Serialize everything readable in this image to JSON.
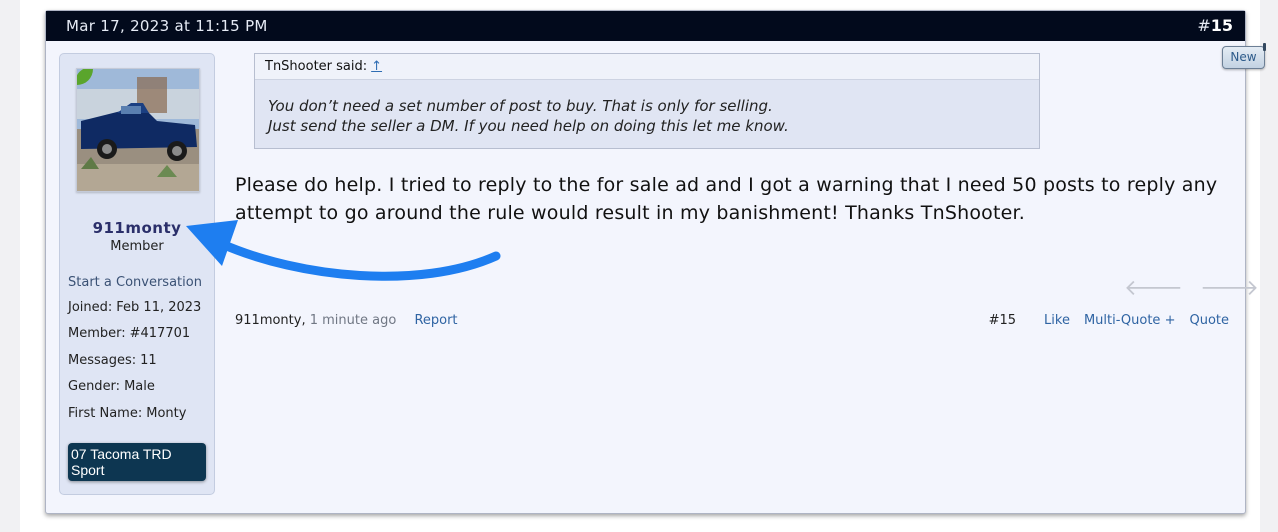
{
  "post": {
    "date": "Mar 17, 2023 at 11:15 PM",
    "number_prefix": "#",
    "number": "15"
  },
  "new_badge": "New",
  "user": {
    "name": "911monty",
    "title": "Member",
    "start_conversation": "Start a Conversation",
    "info": [
      {
        "label": "Joined:",
        "value": "Feb 11, 2023"
      },
      {
        "label": "Member:",
        "value": "#417701"
      },
      {
        "label": "Messages:",
        "value": "11"
      },
      {
        "label": "Gender:",
        "value": "Male"
      },
      {
        "label": "First Name:",
        "value": "Monty"
      }
    ],
    "signature_line1": "07 Tacoma TRD",
    "signature_line2": "Sport"
  },
  "quote": {
    "author": "TnShooter said:",
    "link_icon": "↑",
    "line1": "You don’t need a set number of post to buy. That is only for selling.",
    "line2": "Just send the seller a DM. If you need help on doing this let me know."
  },
  "message": {
    "line1": "Please do help. I tried to reply to the for sale ad and I got a warning that I need 50 posts to reply any",
    "line2": "attempt to go around the rule would result in my banishment! Thanks TnShooter."
  },
  "nav": {
    "prev_icon": "arrow-left-icon",
    "next_icon": "arrow-right-icon"
  },
  "footer": {
    "author": "911monty,",
    "time": "1 minute ago",
    "report": "Report",
    "post_number": "#15",
    "like": "Like",
    "multi_quote": "Multi-Quote +",
    "quote": "Quote"
  },
  "colors": {
    "header_bg": "#020a1c",
    "link": "#2f64a3",
    "annotation_arrow": "#1e7ef0",
    "signature_bg": "#0d3651"
  }
}
